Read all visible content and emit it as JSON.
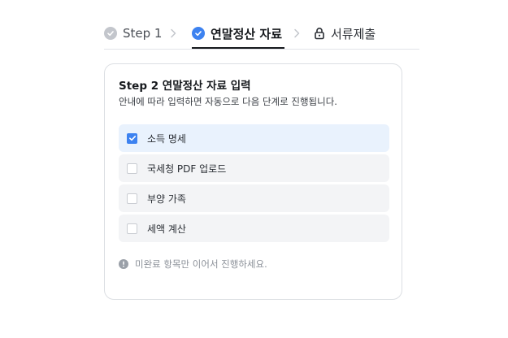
{
  "stepper": {
    "steps": [
      {
        "label": "Step 1",
        "state": "completed",
        "icon": "check-circle-icon"
      },
      {
        "label": "연말정산 자료",
        "state": "active",
        "icon": "check-circle-icon"
      },
      {
        "label": "서류제출",
        "state": "locked",
        "icon": "lock-icon"
      }
    ],
    "separator_icon": "chevron-right-icon"
  },
  "card": {
    "title": "Step 2 연말정산 자료 입력",
    "description": "안내에 따라 입력하면 자동으로 다음 단계로 진행됩니다.",
    "items": [
      {
        "label": "소득 명세",
        "checked": true
      },
      {
        "label": "국세청 PDF 업로드",
        "checked": false
      },
      {
        "label": "부양 가족",
        "checked": false
      },
      {
        "label": "세액 계산",
        "checked": false
      }
    ],
    "notice": "미완료 항목만 이어서 진행하세요.",
    "notice_icon": "info-circle-icon"
  },
  "colors": {
    "accent": "#3d82f0",
    "completed_gray": "#c3c6cc",
    "checked_row_bg": "#e9f2fd",
    "row_bg": "#f3f4f6",
    "text_primary": "#16191d",
    "text_muted": "#8b9098"
  }
}
